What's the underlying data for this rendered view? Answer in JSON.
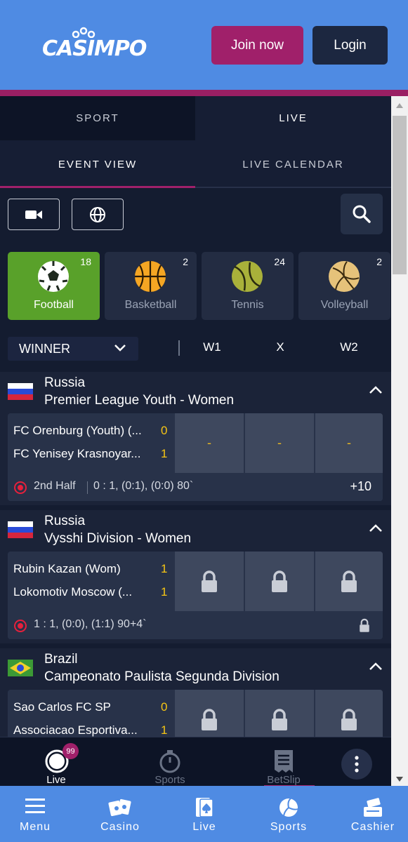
{
  "header": {
    "logo_text": "CASIMPO",
    "join_label": "Join now",
    "login_label": "Login"
  },
  "tabs": {
    "sport_label": "SPORT",
    "live_label": "LIVE",
    "event_view_label": "EVENT VIEW",
    "live_calendar_label": "LIVE CALENDAR"
  },
  "toolbar": {
    "video_icon": "video-camera-icon",
    "globe_icon": "globe-icon",
    "search_icon": "search-icon"
  },
  "sports": [
    {
      "name": "Football",
      "count": "18",
      "icon": "football-icon",
      "active": true
    },
    {
      "name": "Basketball",
      "count": "2",
      "icon": "basketball-icon",
      "active": false
    },
    {
      "name": "Tennis",
      "count": "24",
      "icon": "tennis-ball-icon",
      "active": false
    },
    {
      "name": "Volleyball",
      "count": "2",
      "icon": "volleyball-icon",
      "active": false
    }
  ],
  "market": {
    "selected": "WINNER",
    "columns": [
      "W1",
      "X",
      "W2"
    ]
  },
  "leagues": [
    {
      "country": "Russia",
      "name": "Premier League Youth - Women",
      "flag": "russia-flag",
      "match": {
        "team1": "FC Orenburg (Youth) (...",
        "team2": "FC Yenisey Krasnoyar...",
        "score1": "0",
        "score2": "1",
        "odds": [
          "-",
          "-",
          "-"
        ],
        "period": "2nd Half",
        "detail": "0 : 1, (0:1), (0:0) 80`",
        "more": "+10"
      }
    },
    {
      "country": "Russia",
      "name": "Vysshi Division - Women",
      "flag": "russia-flag",
      "match": {
        "team1": "Rubin Kazan (Wom)",
        "team2": "Lokomotiv Moscow (...",
        "score1": "1",
        "score2": "1",
        "odds_locked": true,
        "detail": "1 : 1, (0:0), (1:1) 90+4`"
      }
    },
    {
      "country": "Brazil",
      "name": "Campeonato Paulista Segunda Division",
      "flag": "brazil-flag",
      "match": {
        "team1": "Sao Carlos FC SP",
        "team2": "Associacao Esportiva...",
        "score1": "0",
        "score2": "1",
        "odds_locked": true
      }
    }
  ],
  "inner_nav": {
    "live_label": "Live",
    "live_badge": "99",
    "sports_label": "Sports",
    "betslip_label": "BetSlip"
  },
  "outer_nav": {
    "menu_label": "Menu",
    "casino_label": "Casino",
    "live_label": "Live",
    "sports_label": "Sports",
    "cashier_label": "Cashier"
  },
  "colors": {
    "header_blue": "#4f8be3",
    "brand_magenta": "#a0206a",
    "active_green": "#59a12a",
    "score_yellow": "#f6c514",
    "live_red": "#e6203c"
  }
}
